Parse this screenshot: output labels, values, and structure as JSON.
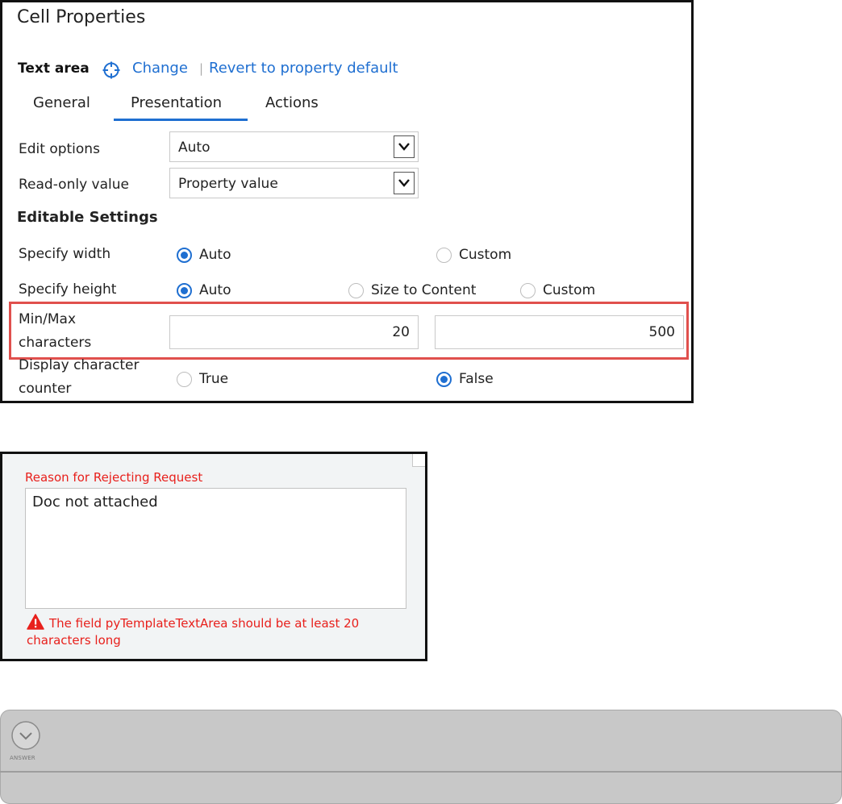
{
  "cell_properties": {
    "title": "Cell Properties",
    "control_type": "Text area",
    "change_link": "Change",
    "separator": "|",
    "revert_link": "Revert to property default",
    "tabs": [
      {
        "label": "General",
        "active": false
      },
      {
        "label": "Presentation",
        "active": true
      },
      {
        "label": "Actions",
        "active": false
      }
    ],
    "edit_options": {
      "label": "Edit options",
      "value": "Auto"
    },
    "read_only_value": {
      "label": "Read-only value",
      "value": "Property value"
    },
    "editable_settings_heading": "Editable Settings",
    "specify_width": {
      "label": "Specify width",
      "options": [
        {
          "label": "Auto",
          "selected": true
        },
        {
          "label": "Custom",
          "selected": false
        }
      ]
    },
    "specify_height": {
      "label": "Specify height",
      "options": [
        {
          "label": "Auto",
          "selected": true
        },
        {
          "label": "Size to Content",
          "selected": false
        },
        {
          "label": "Custom",
          "selected": false
        }
      ]
    },
    "min_max_characters": {
      "label_line1": "Min/Max",
      "label_line2": "characters",
      "min_value": "20",
      "max_value": "500"
    },
    "display_character_counter": {
      "label_line1": "Display character",
      "label_line2": "counter",
      "options": [
        {
          "label": "True",
          "selected": false
        },
        {
          "label": "False",
          "selected": true
        }
      ]
    },
    "colors": {
      "accent": "#1f6fd1",
      "highlight": "#e0504d"
    }
  },
  "validation_example": {
    "field_label": "Reason for Rejecting Request",
    "textarea_value": "Doc not attached",
    "error_line1": "The field pyTemplateTextArea should be at least 20",
    "error_line2": "characters long",
    "icons": {
      "warning": "warning-icon"
    },
    "colors": {
      "error": "#e8201c"
    }
  },
  "answer_bar": {
    "label": "ANSWER",
    "icons": {
      "expand": "chevron-down-circle-icon"
    }
  }
}
